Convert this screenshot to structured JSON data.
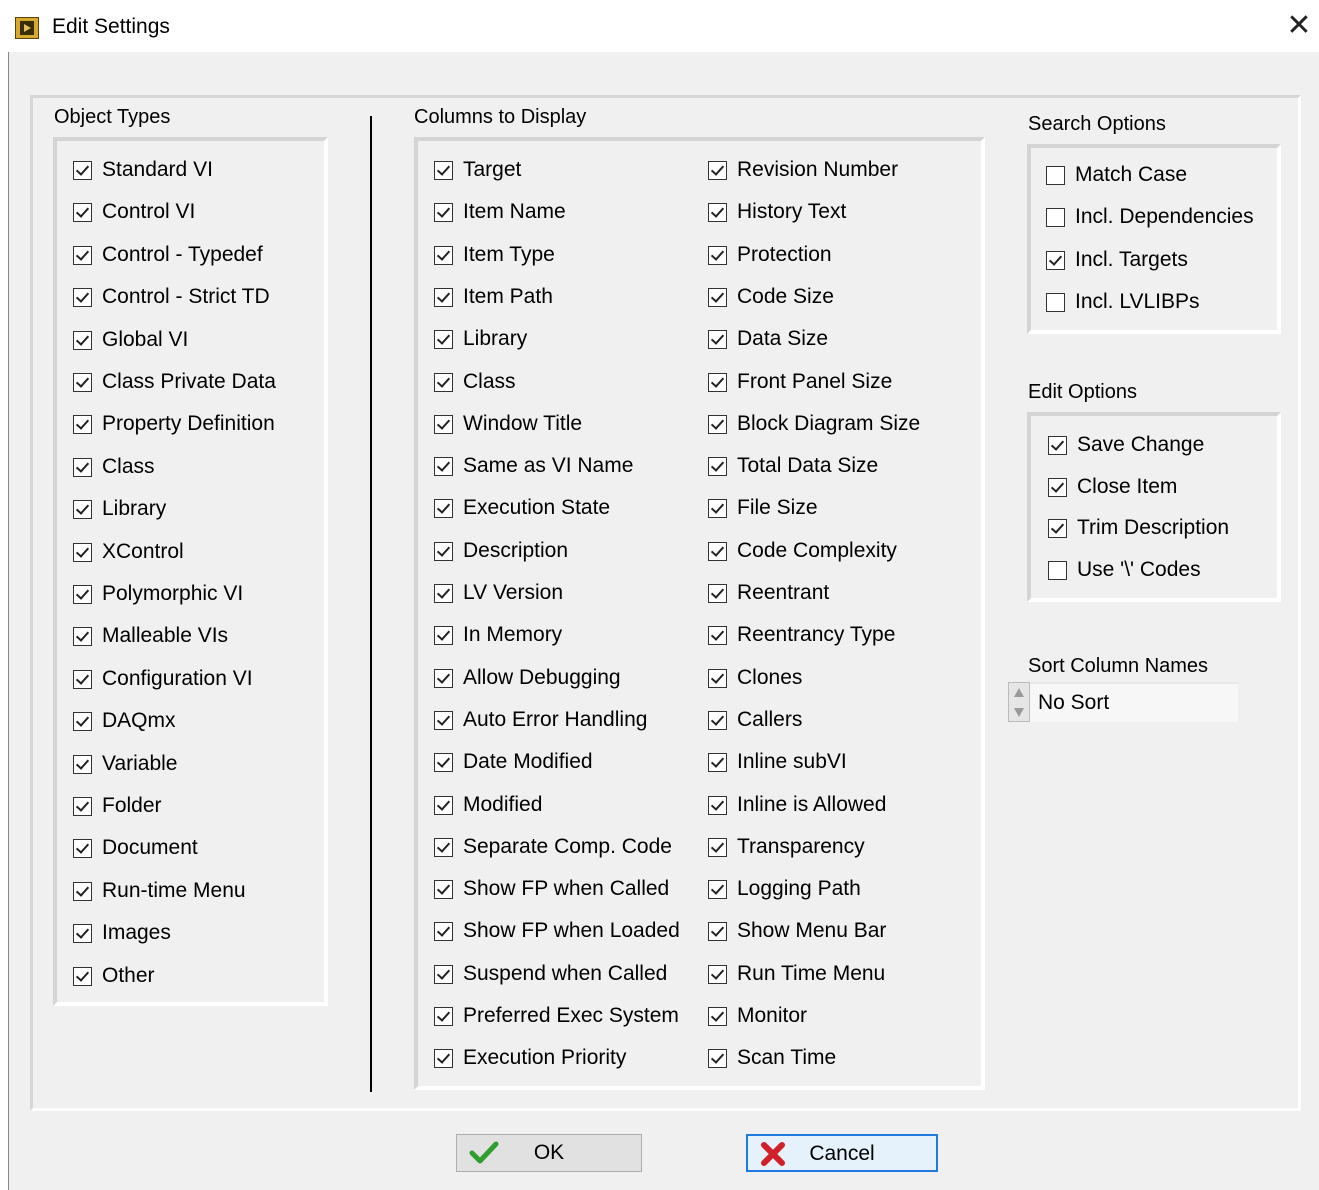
{
  "window": {
    "title": "Edit Settings",
    "icon": "labview-app-icon",
    "close_icon": "close-icon"
  },
  "object_types": {
    "label": "Object Types",
    "items": [
      {
        "label": "Standard VI",
        "checked": true
      },
      {
        "label": "Control VI",
        "checked": true
      },
      {
        "label": "Control - Typedef",
        "checked": true
      },
      {
        "label": "Control - Strict TD",
        "checked": true
      },
      {
        "label": "Global VI",
        "checked": true
      },
      {
        "label": "Class Private Data",
        "checked": true
      },
      {
        "label": "Property Definition",
        "checked": true
      },
      {
        "label": "Class",
        "checked": true
      },
      {
        "label": "Library",
        "checked": true
      },
      {
        "label": "XControl",
        "checked": true
      },
      {
        "label": "Polymorphic VI",
        "checked": true
      },
      {
        "label": "Malleable VIs",
        "checked": true
      },
      {
        "label": "Configuration VI",
        "checked": true
      },
      {
        "label": "DAQmx",
        "checked": true
      },
      {
        "label": "Variable",
        "checked": true
      },
      {
        "label": "Folder",
        "checked": true
      },
      {
        "label": "Document",
        "checked": true
      },
      {
        "label": "Run-time Menu",
        "checked": true
      },
      {
        "label": "Images",
        "checked": true
      },
      {
        "label": "Other",
        "checked": true
      }
    ]
  },
  "columns": {
    "label": "Columns to Display",
    "left": [
      {
        "label": "Target",
        "checked": true
      },
      {
        "label": "Item Name",
        "checked": true
      },
      {
        "label": "Item Type",
        "checked": true
      },
      {
        "label": "Item Path",
        "checked": true
      },
      {
        "label": "Library",
        "checked": true
      },
      {
        "label": "Class",
        "checked": true
      },
      {
        "label": "Window Title",
        "checked": true
      },
      {
        "label": "Same as VI Name",
        "checked": true
      },
      {
        "label": "Execution State",
        "checked": true
      },
      {
        "label": "Description",
        "checked": true
      },
      {
        "label": "LV Version",
        "checked": true
      },
      {
        "label": "In Memory",
        "checked": true
      },
      {
        "label": "Allow Debugging",
        "checked": true
      },
      {
        "label": "Auto Error Handling",
        "checked": true
      },
      {
        "label": "Date Modified",
        "checked": true
      },
      {
        "label": "Modified",
        "checked": true
      },
      {
        "label": "Separate Comp. Code",
        "checked": true
      },
      {
        "label": "Show FP when Called",
        "checked": true
      },
      {
        "label": "Show FP when Loaded",
        "checked": true
      },
      {
        "label": "Suspend when Called",
        "checked": true
      },
      {
        "label": "Preferred Exec System",
        "checked": true
      },
      {
        "label": "Execution Priority",
        "checked": true
      }
    ],
    "right": [
      {
        "label": "Revision Number",
        "checked": true
      },
      {
        "label": "History Text",
        "checked": true
      },
      {
        "label": "Protection",
        "checked": true
      },
      {
        "label": "Code Size",
        "checked": true
      },
      {
        "label": "Data Size",
        "checked": true
      },
      {
        "label": "Front Panel Size",
        "checked": true
      },
      {
        "label": "Block Diagram Size",
        "checked": true
      },
      {
        "label": "Total Data Size",
        "checked": true
      },
      {
        "label": "File Size",
        "checked": true
      },
      {
        "label": "Code Complexity",
        "checked": true
      },
      {
        "label": "Reentrant",
        "checked": true
      },
      {
        "label": "Reentrancy Type",
        "checked": true
      },
      {
        "label": "Clones",
        "checked": true
      },
      {
        "label": "Callers",
        "checked": true
      },
      {
        "label": "Inline subVI",
        "checked": true
      },
      {
        "label": "Inline is Allowed",
        "checked": true
      },
      {
        "label": "Transparency",
        "checked": true
      },
      {
        "label": "Logging Path",
        "checked": true
      },
      {
        "label": "Show Menu Bar",
        "checked": true
      },
      {
        "label": "Run Time Menu",
        "checked": true
      },
      {
        "label": "Monitor",
        "checked": true
      },
      {
        "label": "Scan Time",
        "checked": true
      }
    ]
  },
  "search_options": {
    "label": "Search Options",
    "items": [
      {
        "label": "Match Case",
        "checked": false
      },
      {
        "label": "Incl. Dependencies",
        "checked": false
      },
      {
        "label": "Incl. Targets",
        "checked": true
      },
      {
        "label": "Incl. LVLIBPs",
        "checked": false
      }
    ]
  },
  "edit_options": {
    "label": "Edit Options",
    "items": [
      {
        "label": "Save Change",
        "checked": true
      },
      {
        "label": "Close Item",
        "checked": true
      },
      {
        "label": "Trim Description",
        "checked": true
      },
      {
        "label": "Use '\\' Codes",
        "checked": false
      }
    ]
  },
  "sort": {
    "label": "Sort Column Names",
    "value": "No Sort"
  },
  "buttons": {
    "ok": {
      "label": "OK",
      "icon": "checkmark-icon",
      "icon_color": "#2e9e2e"
    },
    "cancel": {
      "label": "Cancel",
      "icon": "red-x-icon",
      "icon_color": "#d0202a"
    }
  }
}
